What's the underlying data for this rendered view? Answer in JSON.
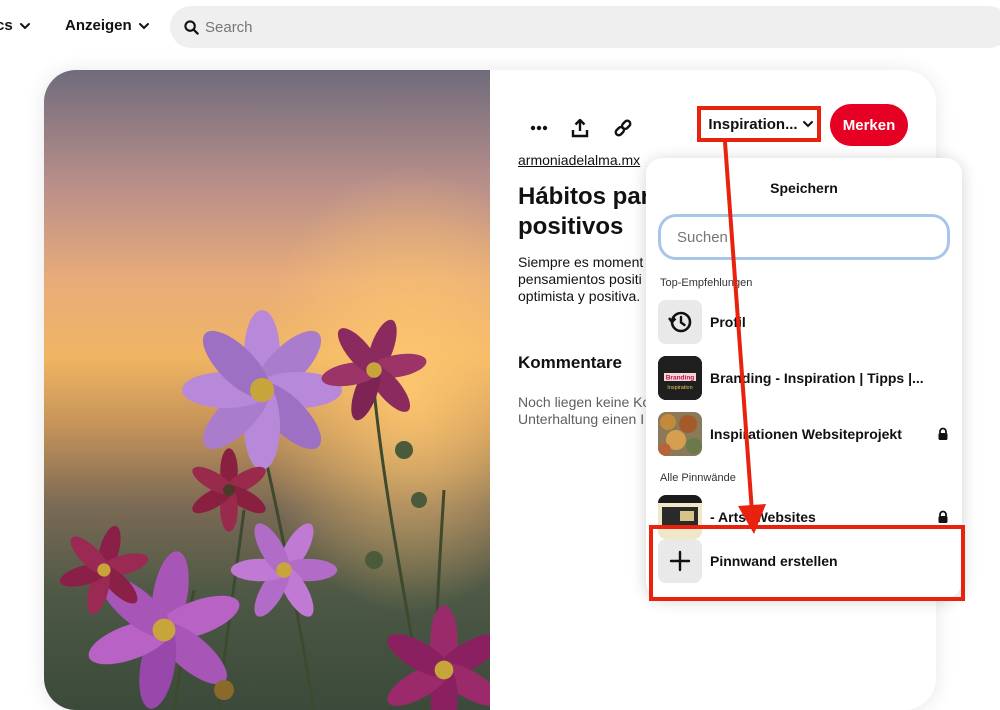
{
  "topbar": {
    "nav_partial": "cs",
    "nav_anzeigen": "Anzeigen",
    "search_placeholder": "Search"
  },
  "pin": {
    "source": "armoniadelalma.mx",
    "title_line1": "Hábitos par",
    "title_line2": "positivos",
    "desc_line1": "Siempre es moment",
    "desc_line2": "pensamientos positi",
    "desc_line3": "optimista y positiva.",
    "comments_heading": "Kommentare",
    "comments_line1": "Noch liegen keine Ko",
    "comments_line2": "Unterhaltung einen I"
  },
  "actions": {
    "more_icon": "more-horizontal-icon",
    "share_icon": "share-upload-icon",
    "link_icon": "link-icon",
    "board_select_label": "Inspiration...",
    "save_label": "Merken"
  },
  "dropdown": {
    "title": "Speichern",
    "search_placeholder": "Suchen",
    "section_top": "Top-Empfehlungen",
    "section_all": "Alle Pinnwände",
    "boards_top": [
      {
        "label": "Profil",
        "icon": "history-icon",
        "locked": false
      },
      {
        "label": "Branding - Inspiration | Tipps |...",
        "thumb_text_1": "Branding",
        "thumb_text_2": "Inspiration",
        "locked": false
      },
      {
        "label": "Inspirationen Websiteprojekt",
        "locked": true
      }
    ],
    "boards_all": [
      {
        "label": "- Arts- Websites",
        "locked": true
      }
    ],
    "create_label": "Pinnwand erstellen",
    "create_icon": "plus-icon"
  },
  "annotation": {
    "color": "#e8220f"
  },
  "colors": {
    "primary_red": "#e60023",
    "search_bg": "#efefef",
    "focus_ring": "#a8c5ea"
  }
}
